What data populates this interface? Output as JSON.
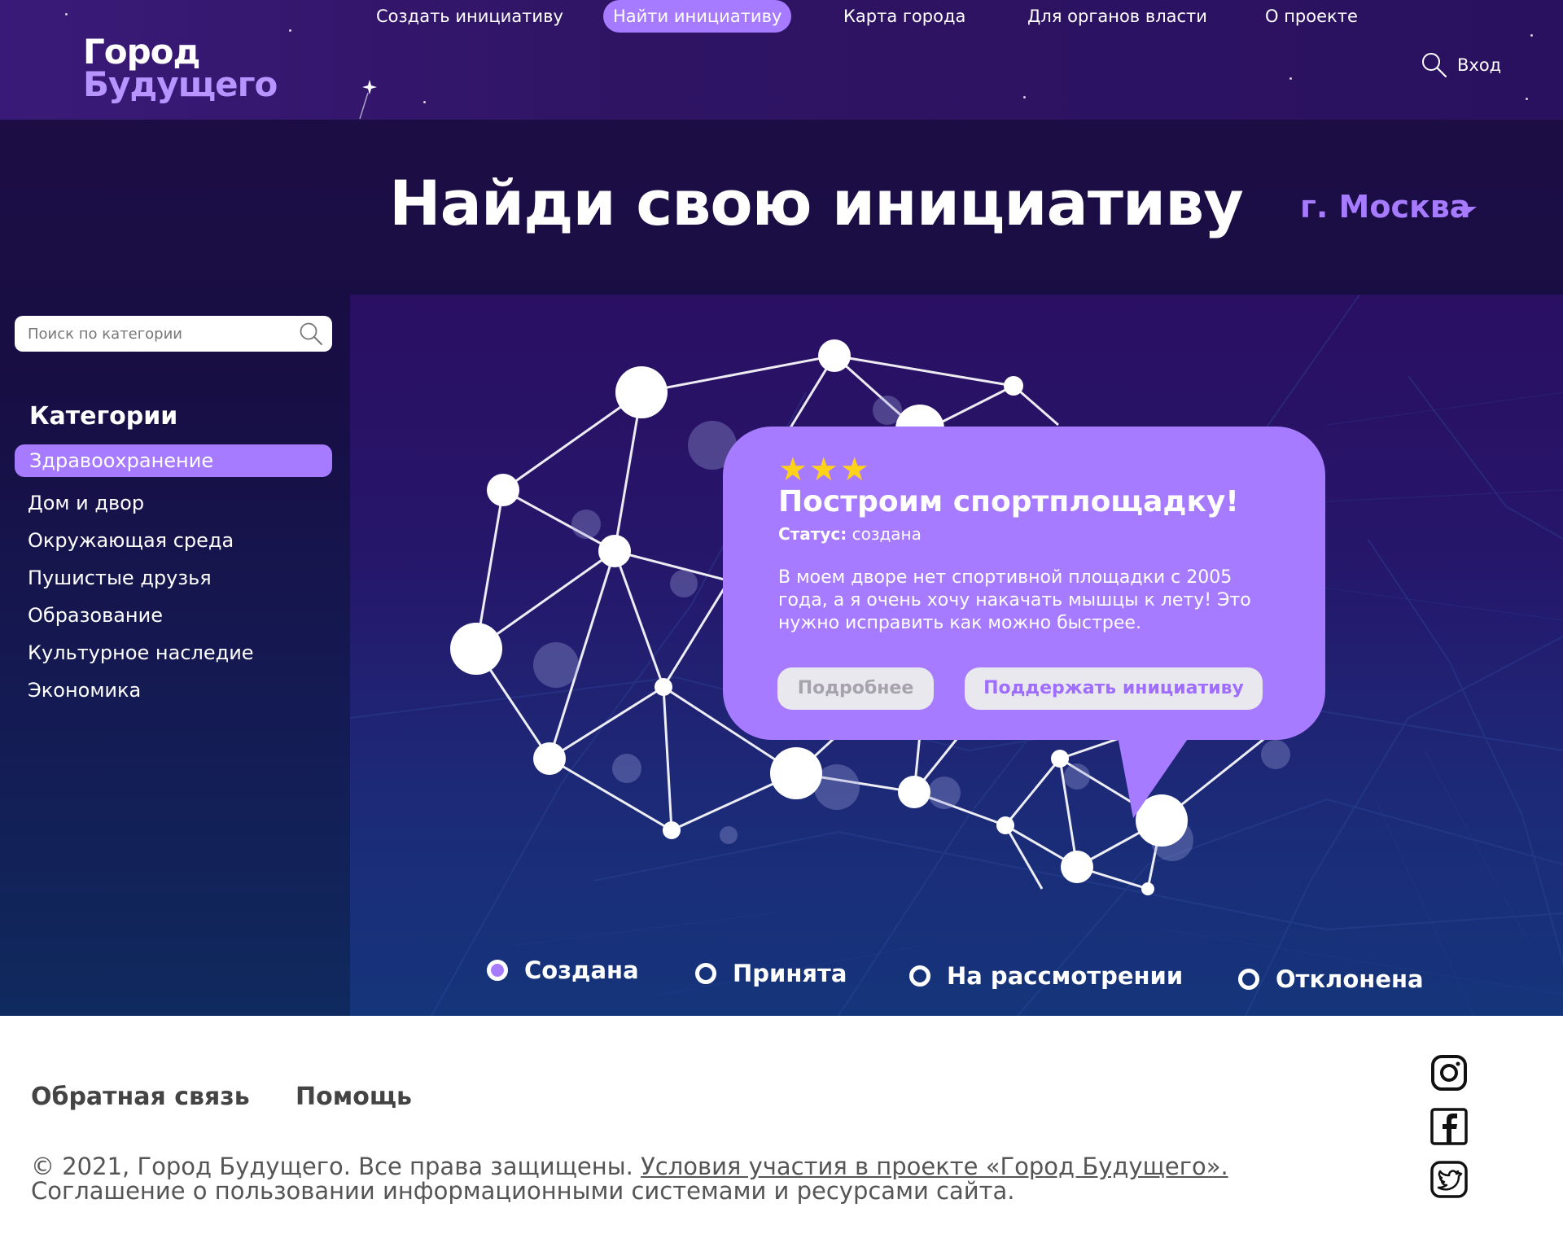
{
  "brand": {
    "line1": "Город",
    "line2": "Будущего"
  },
  "nav": {
    "items": [
      {
        "label": "Создать инициативу",
        "active": false
      },
      {
        "label": "Найти инициативу",
        "active": true
      },
      {
        "label": "Карта города",
        "active": false
      },
      {
        "label": "Для органов власти",
        "active": false
      },
      {
        "label": "О проекте",
        "active": false
      }
    ],
    "search_icon": "search-icon",
    "login": "Вход"
  },
  "hero": {
    "title": "Найди свою инициативу",
    "city": "г. Москва"
  },
  "sidebar": {
    "search_placeholder": "Поиск по категории",
    "categories_title": "Категории",
    "categories": [
      {
        "label": "Здравоохранение",
        "active": true
      },
      {
        "label": "Дом и двор",
        "active": false
      },
      {
        "label": "Окружающая среда",
        "active": false
      },
      {
        "label": "Пушистые друзья",
        "active": false
      },
      {
        "label": "Образование",
        "active": false
      },
      {
        "label": "Культурное наследие",
        "active": false
      },
      {
        "label": "Экономика",
        "active": false
      }
    ]
  },
  "initiative": {
    "rating": 3,
    "stars": "★★★",
    "title": "Построим спортплощадку!",
    "status_label": "Статус:",
    "status_value": "создана",
    "description": "В моем дворе нет спортивной площадки с 2005 года, а я очень хочу накачать мышцы к лету! Это нужно исправить как можно быстрее.",
    "btn_more": "Подробнее",
    "btn_support": "Поддержать инициативу"
  },
  "statuses": [
    {
      "label": "Создана",
      "selected": true
    },
    {
      "label": "Принята",
      "selected": false
    },
    {
      "label": "На рассмотрении",
      "selected": false
    },
    {
      "label": "Отклонена",
      "selected": false
    }
  ],
  "footer": {
    "feedback": "Обратная связь",
    "help": "Помощь",
    "copyright": "© 2021, Город Будущего. Все права защищены.",
    "terms_link": "Условия участия в проекте «Город Будущего».",
    "agreement": "Соглашение о пользовании информационными системами и ресурсами сайта.",
    "social": [
      "instagram-icon",
      "facebook-icon",
      "twitter-icon"
    ]
  },
  "colors": {
    "accent": "#a77bff",
    "header_bg": "#2f1464",
    "star": "#ffd21a"
  }
}
